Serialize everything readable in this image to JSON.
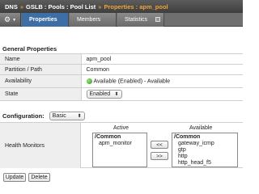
{
  "breadcrumb": {
    "items": [
      "DNS",
      "GSLB : Pools : Pool List"
    ],
    "separator": "»",
    "current": "Properties : apm_pool"
  },
  "tabs": {
    "gear_icon": "gear-icon",
    "items": [
      {
        "label": "Properties",
        "active": true
      },
      {
        "label": "Members",
        "active": false
      },
      {
        "label": "Statistics",
        "active": false
      }
    ]
  },
  "general": {
    "title": "General Properties",
    "rows": [
      {
        "label": "Name",
        "value": "apm_pool"
      },
      {
        "label": "Partition / Path",
        "value": "Common"
      },
      {
        "label": "Availability",
        "value": "Available (Enabled) - Available"
      },
      {
        "label": "State",
        "value": "Enabled"
      }
    ]
  },
  "configuration": {
    "label": "Configuration:",
    "selected": "Basic"
  },
  "health_monitors": {
    "label": "Health Monitors",
    "active_heading": "Active",
    "available_heading": "Available",
    "active_group": "/Common",
    "active_items": [
      "apm_monitor"
    ],
    "available_group": "/Common",
    "available_items": [
      "gateway_icmp",
      "gtp",
      "http",
      "http_head_f5"
    ],
    "move_left_label": "<<",
    "move_right_label": ">>"
  },
  "actions": {
    "update_label": "Update",
    "delete_label": "Delete"
  },
  "colors": {
    "active_tab": "#3d6ea6",
    "breadcrumb_current": "#f0a535",
    "status_available": "#2f9a1a"
  }
}
